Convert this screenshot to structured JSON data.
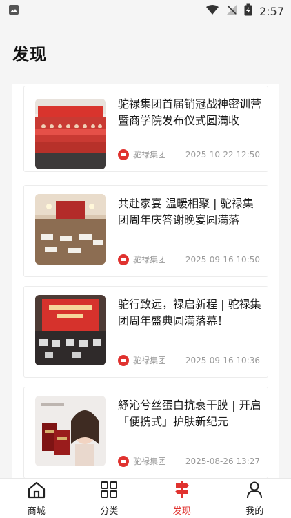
{
  "status_bar": {
    "time": "2:57",
    "icons": [
      "gallery-icon",
      "wifi-icon",
      "signal-icon",
      "battery-icon"
    ]
  },
  "header": {
    "title": "发现"
  },
  "feed": {
    "articles": [
      {
        "title": "驼禄集团首届销冠战神密训营暨商学院发布仪式圆满收",
        "source": "驼禄集团",
        "date": "2025-10-22 12:50"
      },
      {
        "title": "共赴家宴 温暖相聚 | 驼禄集团周年庆答谢晚宴圆满落",
        "source": "驼禄集团",
        "date": "2025-09-16 10:50"
      },
      {
        "title": "驼行致远，禄启新程 | 驼禄集团周年盛典圆满落幕！",
        "source": "驼禄集团",
        "date": "2025-09-16 10:36"
      },
      {
        "title": "紓沁兮丝蛋白抗衰干膜 | 开启「便携式」护肤新纪元",
        "source": "驼禄集团",
        "date": "2025-08-26 13:27"
      }
    ]
  },
  "tab_bar": {
    "tabs": [
      {
        "label": "商城",
        "icon": "home-icon"
      },
      {
        "label": "分类",
        "icon": "grid-icon"
      },
      {
        "label": "发现",
        "icon": "signpost-icon"
      },
      {
        "label": "我的",
        "icon": "person-icon"
      }
    ],
    "active_color": "#e0322f",
    "inactive_color": "#222222"
  }
}
